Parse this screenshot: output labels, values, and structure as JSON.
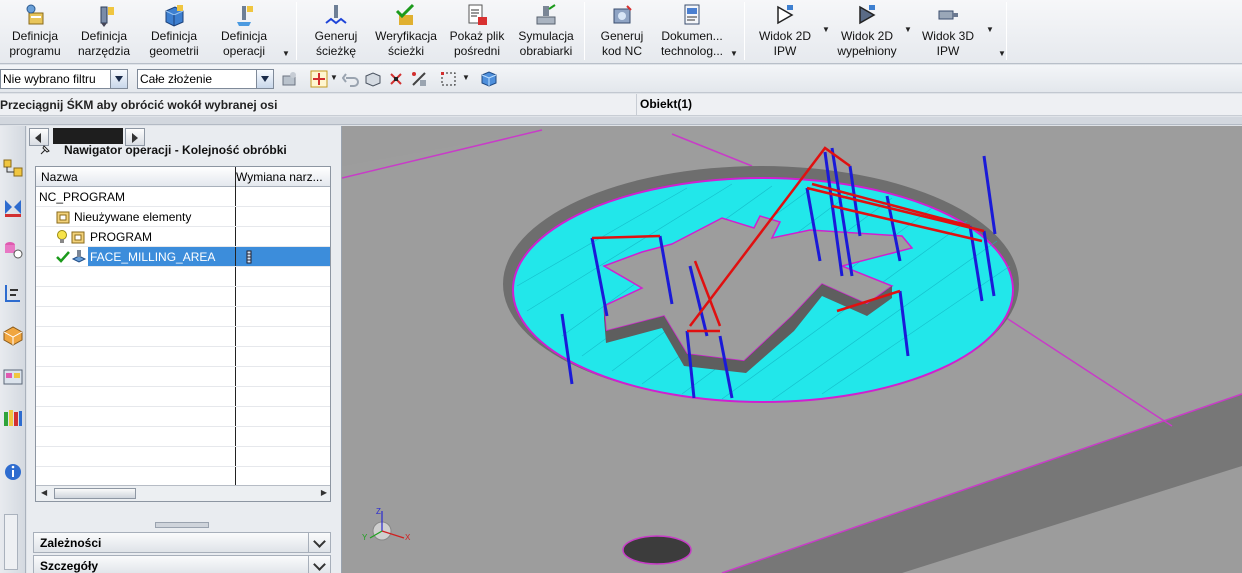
{
  "ribbon": {
    "buttons": [
      {
        "line1": "Definicja",
        "line2": "programu",
        "icon": "program-definition-icon"
      },
      {
        "line1": "Definicja",
        "line2": "narzędzia",
        "icon": "tool-definition-icon"
      },
      {
        "line1": "Definicja",
        "line2": "geometrii",
        "icon": "geometry-definition-icon"
      },
      {
        "line1": "Definicja",
        "line2": "operacji",
        "icon": "operation-definition-icon"
      },
      {
        "line1": "Generuj",
        "line2": "ścieżkę",
        "icon": "generate-path-icon"
      },
      {
        "line1": "Weryfikacja",
        "line2": "ścieżki",
        "icon": "verify-path-icon"
      },
      {
        "line1": "Pokaż plik",
        "line2": "pośredni",
        "icon": "show-file-icon"
      },
      {
        "line1": "Symulacja",
        "line2": "obrabiarki",
        "icon": "machine-simulation-icon"
      },
      {
        "line1": "Generuj",
        "line2": "kod NC",
        "icon": "generate-nc-icon"
      },
      {
        "line1": "Dokumen...",
        "line2": "technolog...",
        "icon": "documentation-icon"
      },
      {
        "line1": "Widok 2D",
        "line2": "IPW",
        "icon": "view-2d-ipw-icon"
      },
      {
        "line1": "Widok 2D",
        "line2": "wypełniony",
        "icon": "view-2d-filled-icon"
      },
      {
        "line1": "Widok 3D",
        "line2": "IPW",
        "icon": "view-3d-ipw-icon"
      }
    ]
  },
  "toolbar": {
    "filter_value": "Nie wybrano filtru",
    "assembly_value": "Całe złożenie"
  },
  "status": {
    "prompt": "Przeciągnij ŚKM aby obrócić wokół wybranej osi",
    "object": "Obiekt(1)"
  },
  "navigator": {
    "title": "Nawigator operacji - Kolejność obróbki",
    "col_name": "Nazwa",
    "col_tool_change": "Wymiana narz...",
    "rows": [
      {
        "label": "NC_PROGRAM"
      },
      {
        "label": "Nieużywane elementy"
      },
      {
        "label": "PROGRAM"
      },
      {
        "label": "FACE_MILLING_AREA"
      }
    ],
    "panel_dependencies": "Zależności",
    "panel_details": "Szczegóły"
  },
  "colors": {
    "accent_selection": "#3c8ddb",
    "toolpath_cut": "#0b1fd6",
    "toolpath_rapid": "#e01010",
    "floor_fill": "#20e8ec",
    "edge_magenta": "#d020d0",
    "model_gray": "#9c9c9c"
  }
}
